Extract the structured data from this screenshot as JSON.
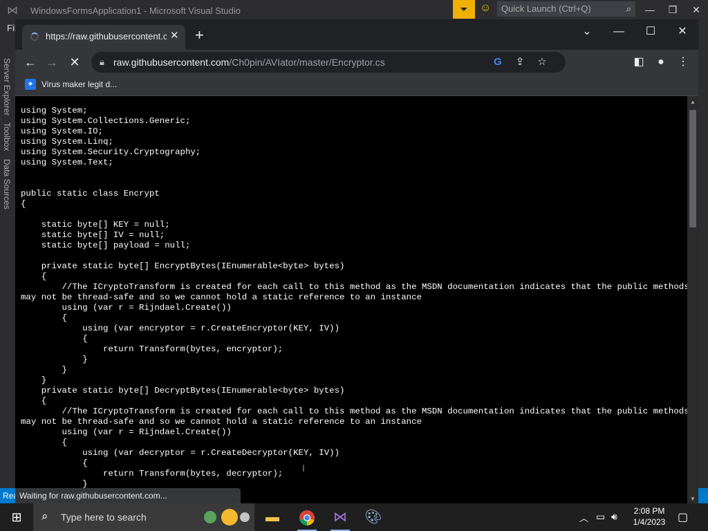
{
  "vs": {
    "title": "WindowsFormsApplication1 - Microsoft Visual Studio",
    "quick_launch_placeholder": "Quick Launch (Ctrl+Q)",
    "file_menu": "Fil",
    "side_tabs": [
      "Server Explorer",
      "Toolbox",
      "Data Sources"
    ],
    "status": "Rea"
  },
  "browser": {
    "tab_title": "https://raw.githubusercontent.co",
    "url_host": "raw.githubusercontent.com",
    "url_path": "/Ch0pin/AVIator/master/Encryptor.cs",
    "bookmark_label": "Virus maker legit d...",
    "status_text": "Waiting for raw.githubusercontent.com..."
  },
  "code_lines": [
    "using System;",
    "using System.Collections.Generic;",
    "using System.IO;",
    "using System.Linq;",
    "using System.Security.Cryptography;",
    "using System.Text;",
    "",
    "",
    "public static class Encrypt",
    "{",
    "",
    "    static byte[] KEY = null;",
    "    static byte[] IV = null;",
    "    static byte[] payload = null;",
    "",
    "    private static byte[] EncryptBytes(IEnumerable<byte> bytes)",
    "    {",
    "        //The ICryptoTransform is created for each call to this method as the MSDN documentation indicates that the public methods",
    "may not be thread-safe and so we cannot hold a static reference to an instance",
    "        using (var r = Rijndael.Create())",
    "        {",
    "            using (var encryptor = r.CreateEncryptor(KEY, IV))",
    "            {",
    "                return Transform(bytes, encryptor);",
    "            }",
    "        }",
    "    }",
    "    private static byte[] DecryptBytes(IEnumerable<byte> bytes)",
    "    {",
    "        //The ICryptoTransform is created for each call to this method as the MSDN documentation indicates that the public methods",
    "may not be thread-safe and so we cannot hold a static reference to an instance",
    "        using (var r = Rijndael.Create())",
    "        {",
    "            using (var decryptor = r.CreateDecryptor(KEY, IV))",
    "            {",
    "                return Transform(bytes, decryptor);",
    "            }"
  ],
  "taskbar": {
    "search_placeholder": "Type here to search",
    "time": "2:08 PM",
    "date": "1/4/2023"
  },
  "icons": {
    "back": "arrow-left-icon",
    "forward": "arrow-right-icon",
    "stop": "stop-icon",
    "lock": "lock-icon",
    "google": "google-icon",
    "share": "share-icon",
    "star": "star-icon",
    "sidepanel": "side-panel-icon",
    "profile": "profile-icon",
    "menu": "kebab-menu-icon"
  },
  "colors": {
    "chrome_dark": "#202124",
    "chrome_toolbar": "#35363a",
    "vs_accent": "#007acc",
    "code_bg": "#000000",
    "code_fg": "#ffffff"
  }
}
